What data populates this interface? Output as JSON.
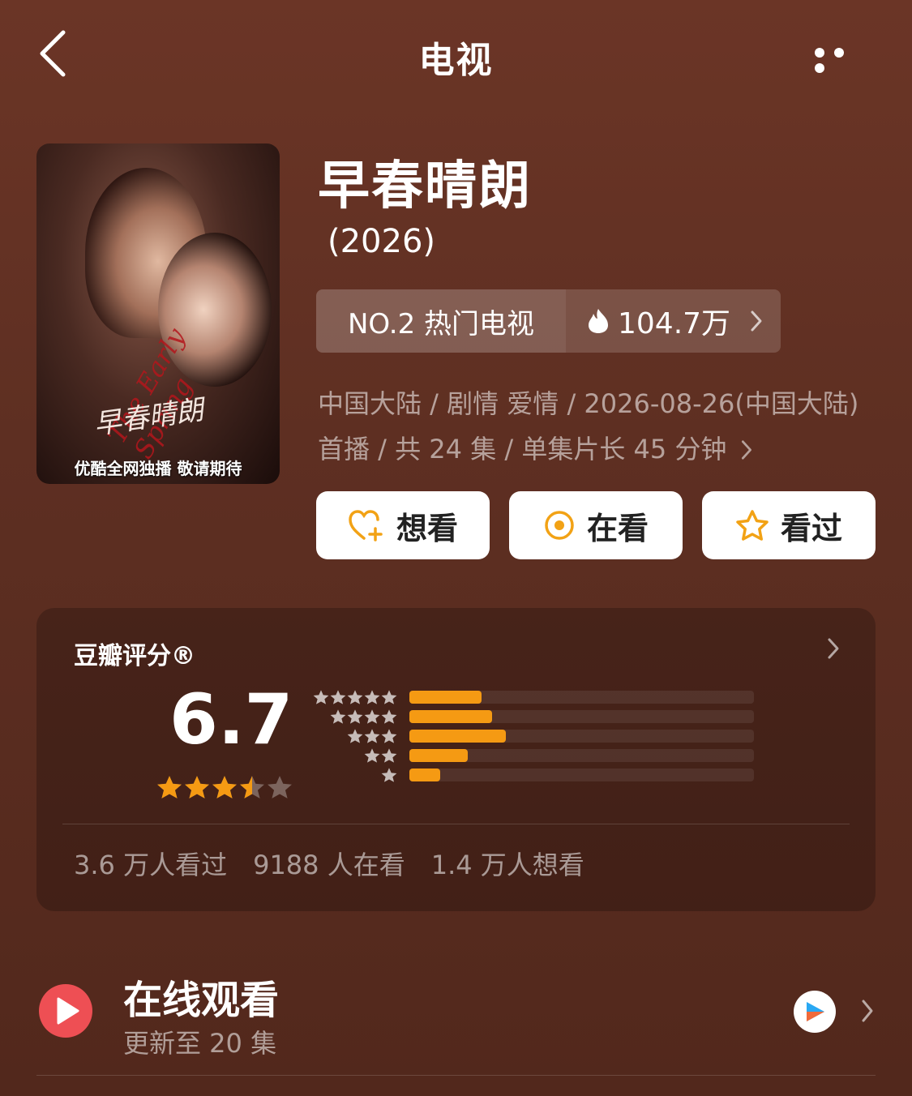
{
  "header": {
    "title": "电视"
  },
  "show": {
    "title": "早春晴朗",
    "year": "(2026)",
    "rank_label": "NO.2 热门电视",
    "heat_value": "104.7万",
    "meta_line": "中国大陆 / 剧情 爱情 / 2026-08-26(中国大陆) 首播 / 共 24 集 / 单集片长 45 分钟",
    "poster": {
      "caption": "优酷全网独播 敬请期待",
      "script_title": "早春晴朗",
      "red_script": "The Early Spring"
    }
  },
  "actions": [
    {
      "label": "想看",
      "icon": "heart-plus-icon"
    },
    {
      "label": "在看",
      "icon": "target-circle-icon"
    },
    {
      "label": "看过",
      "icon": "star-outline-icon"
    }
  ],
  "rating": {
    "label": "豆瓣评分®",
    "score": "6.7",
    "score_stars": 3.5,
    "distribution": [
      {
        "stars": 5,
        "fraction": 0.21
      },
      {
        "stars": 4,
        "fraction": 0.24
      },
      {
        "stars": 3,
        "fraction": 0.28
      },
      {
        "stars": 2,
        "fraction": 0.17
      },
      {
        "stars": 1,
        "fraction": 0.09
      }
    ],
    "stats": [
      "3.6 万人看过",
      "9188 人在看",
      "1.4 万人想看"
    ]
  },
  "watch": {
    "title": "在线观看",
    "subtitle": "更新至 20 集",
    "provider_icon": "youku-logo-icon"
  },
  "colors": {
    "accent": "#f59a13",
    "play_red": "#ee4f54",
    "background": "#5e2f22"
  }
}
